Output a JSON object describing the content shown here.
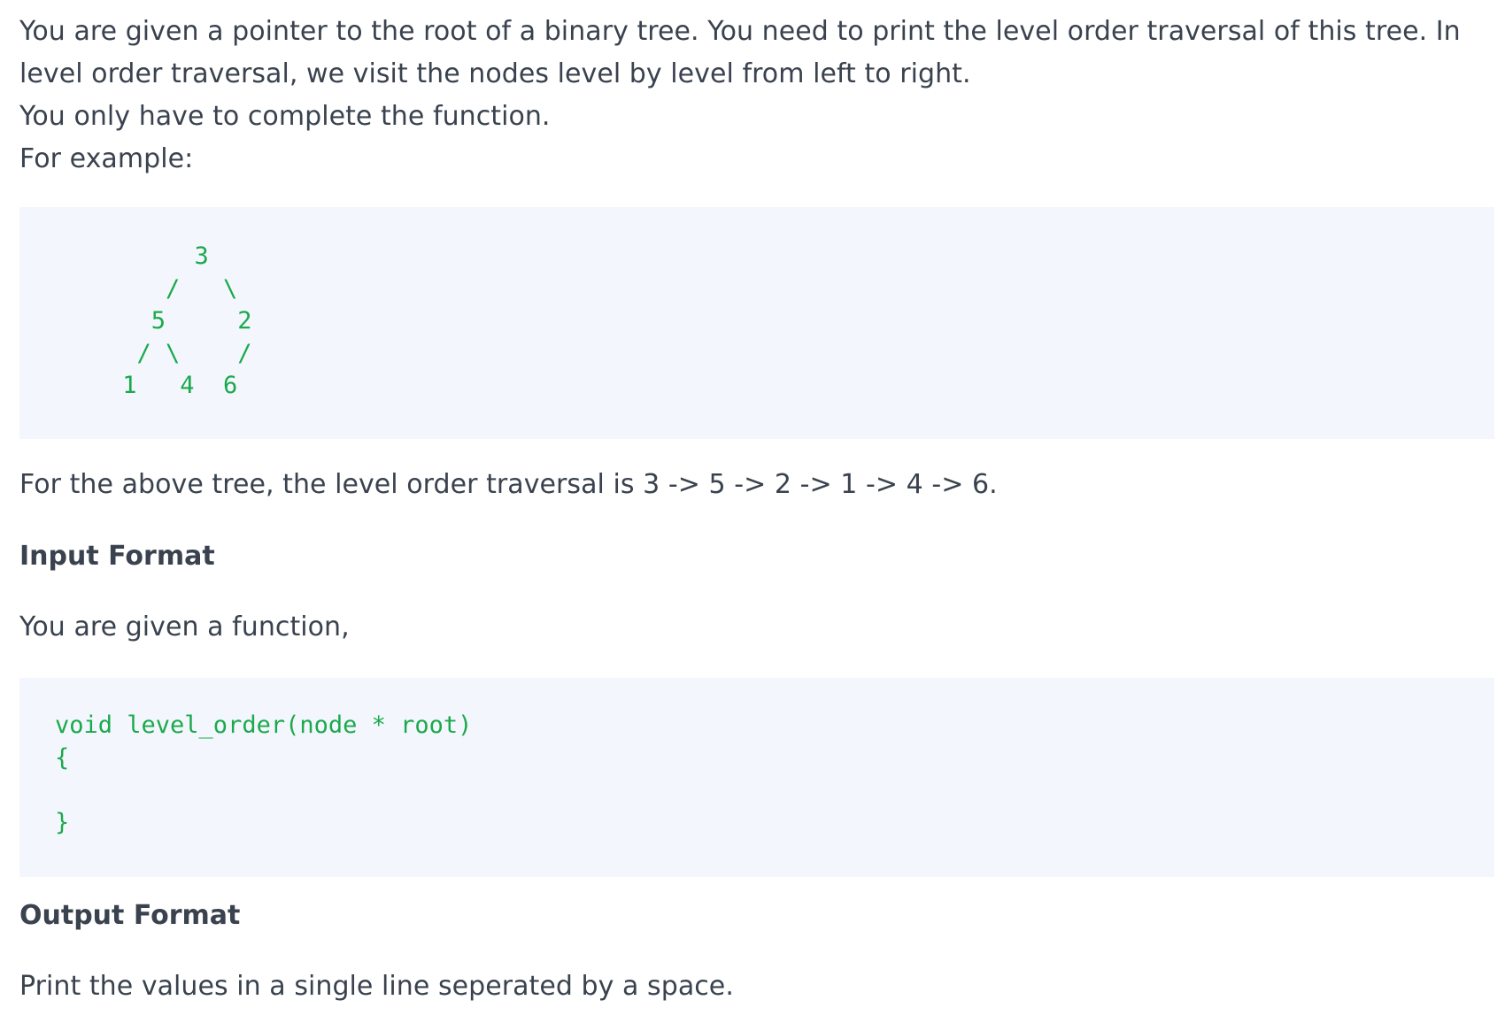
{
  "intro": {
    "line1": "You are given a pointer to the root of a binary tree. You need to print the level order traversal of this tree. In level order traversal, we visit the nodes level by level from left to right.",
    "line2": "You only have to complete the function.",
    "line3": "For example:"
  },
  "tree_example": {
    "code": "      3\n    /   \\\n   5     2\n  / \\    /\n 1   4  6"
  },
  "example_text": "For the above tree, the level order traversal is 3 -> 5 -> 2 -> 1 -> 4 -> 6.",
  "input_format": {
    "heading": "Input Format",
    "text": "You are given a function,",
    "code": "void level_order(node * root)\n{\n\n}"
  },
  "output_format": {
    "heading": "Output Format",
    "text": "Print the values in a single line seperated by a space."
  },
  "colors": {
    "text": "#39424e",
    "code": "#1ba94c",
    "code_background": "#f3f7fd"
  }
}
